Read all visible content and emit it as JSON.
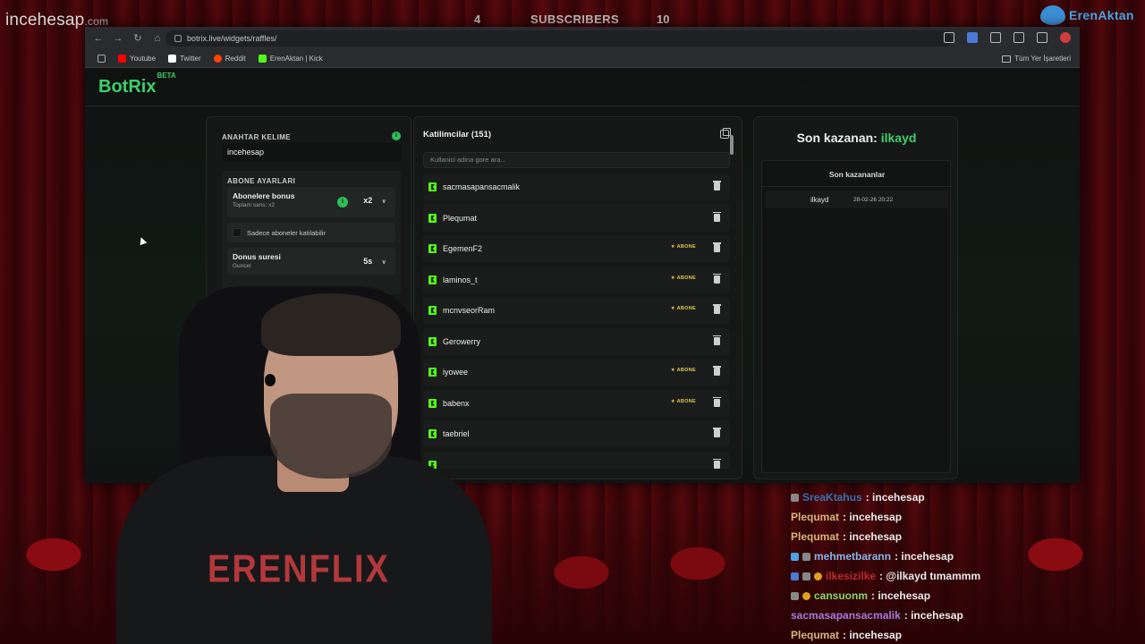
{
  "overlay": {
    "brand_left_main": "incehesap",
    "brand_left_suffix": ".com",
    "sub_left": "4",
    "sub_label": "SUBSCRIBERS",
    "sub_right": "10",
    "twitter_handle": "ErenAktan"
  },
  "browser": {
    "url": "botrix.live/widgets/raffles/",
    "bookmarks": [
      {
        "label": "Youtube",
        "color": "#ff0000"
      },
      {
        "label": "Twitter",
        "color": "#ffffff"
      },
      {
        "label": "Reddit",
        "color": "#ff4500"
      },
      {
        "label": "ErenAktan | Kick",
        "color": "#53fc18"
      }
    ],
    "bookmarks_folder": "Tüm Yer İşaretleri"
  },
  "app": {
    "logo": "BotRix",
    "logo_badge": "BETA",
    "accent": "#3ecf6a"
  },
  "settings": {
    "keyword_label": "ANAHTAR KELIME",
    "keyword_value": "incehesap",
    "sub_settings_label": "ABONE AYARLARI",
    "sub_bonus_title": "Abonelere bonus",
    "sub_bonus_sub": "Toplam sans: x2",
    "sub_bonus_value": "x2",
    "sub_only_label": "Sadece aboneler katilabilir",
    "duration_title": "Donus suresi",
    "duration_sub": "Guncel",
    "duration_value": "5s"
  },
  "participants": {
    "title": "Katilimcilar (151)",
    "search_placeholder": "Kullanici adina gore ara...",
    "rows": [
      {
        "name": "sacmasapansacmalik",
        "badge": ""
      },
      {
        "name": "Plequmat",
        "badge": ""
      },
      {
        "name": "EgemenF2",
        "badge": "★ ABONE"
      },
      {
        "name": "laminos_t",
        "badge": "★ ABONE"
      },
      {
        "name": "mcnvseorRam",
        "badge": "★ ABONE"
      },
      {
        "name": "Gerowerry",
        "badge": ""
      },
      {
        "name": "iyowee",
        "badge": "★ ABONE"
      },
      {
        "name": "babenx",
        "badge": "★ ABONE"
      },
      {
        "name": "taebriel",
        "badge": ""
      },
      {
        "name": "",
        "badge": ""
      }
    ]
  },
  "winner": {
    "label": "Son kazanan:",
    "name": "ilkayd",
    "recent_title": "Son kazananlar",
    "recent": [
      {
        "name": "ilkayd",
        "date": "28-02-26 20:22"
      }
    ]
  },
  "stream": {
    "shirt_text": "ERENFLIX"
  },
  "chat": [
    {
      "user": "SreaKtahus",
      "text": ": incehesap",
      "color": "#3b6fb0"
    },
    {
      "user": "Plequmat",
      "text": ": incehesap",
      "color": "#d8b37a"
    },
    {
      "user": "Plequmat",
      "text": ": incehesap",
      "color": "#d8b37a"
    },
    {
      "user": "mehmetbarann",
      "text": ": incehesap",
      "color": "#8ab4e8"
    },
    {
      "user": "ilkesizilke",
      "text": ": @ilkayd tımammm",
      "color": "#c0282e"
    },
    {
      "user": "cansuonm",
      "text": ": incehesap",
      "color": "#8ad46a"
    },
    {
      "user": "sacmasapansacmalik",
      "text": ": incehesap",
      "color": "#a77be0"
    },
    {
      "user": "Plequmat",
      "text": ": incehesap",
      "color": "#d8b37a"
    }
  ]
}
